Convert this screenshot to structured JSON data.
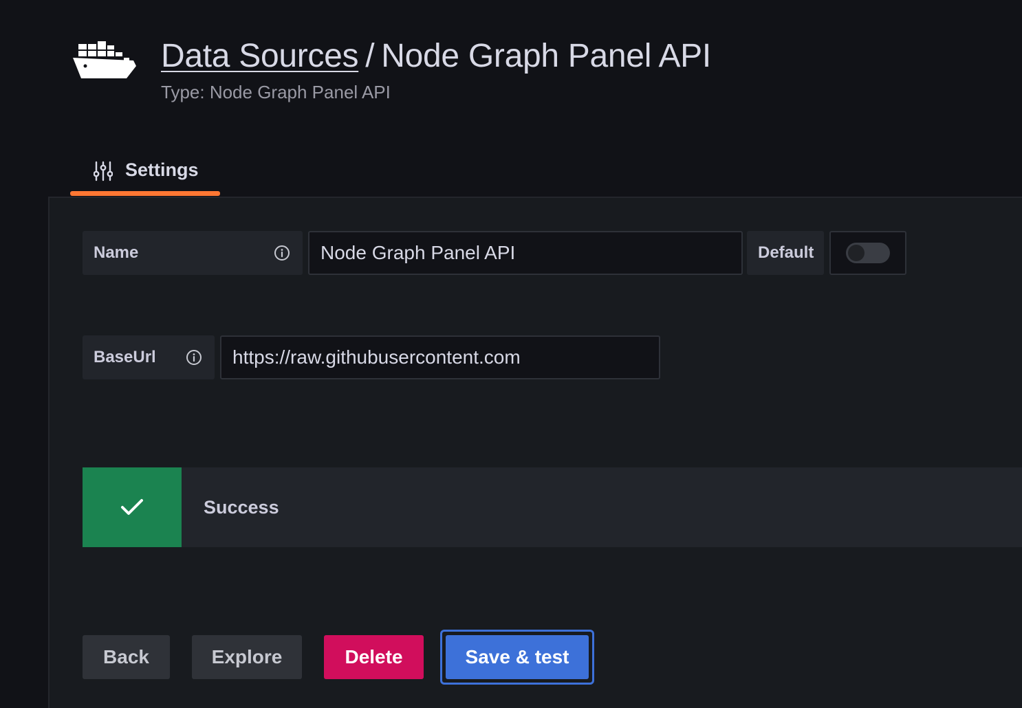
{
  "header": {
    "breadcrumb_link": "Data Sources",
    "separator": "/",
    "title": "Node Graph Panel API",
    "subtitle": "Type: Node Graph Panel API",
    "logo_icon": "cargo-ship-icon"
  },
  "tabs": [
    {
      "label": "Settings",
      "icon": "sliders-icon",
      "active": true
    }
  ],
  "form": {
    "name_label": "Name",
    "name_value": "Node Graph Panel API",
    "default_label": "Default",
    "default_enabled": false,
    "baseurl_label": "BaseUrl",
    "baseurl_value": "https://raw.githubusercontent.com"
  },
  "alert": {
    "status": "success",
    "text": "Success",
    "icon": "check-icon"
  },
  "buttons": {
    "back": "Back",
    "explore": "Explore",
    "delete": "Delete",
    "save_test": "Save & test"
  },
  "colors": {
    "accent_tab": "#ff7733",
    "success": "#1b8350",
    "danger": "#d10e5c",
    "primary": "#3d71d9"
  }
}
